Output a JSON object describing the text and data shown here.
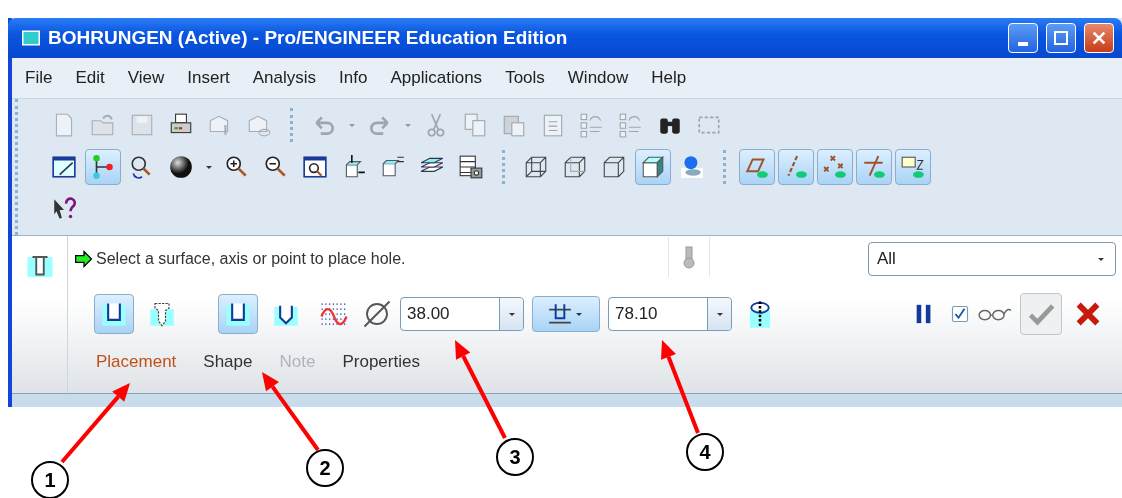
{
  "window": {
    "title": "BOHRUNGEN (Active) - Pro/ENGINEER Education Edition"
  },
  "menu": [
    "File",
    "Edit",
    "View",
    "Insert",
    "Analysis",
    "Info",
    "Applications",
    "Tools",
    "Window",
    "Help"
  ],
  "toolbars": [
    [
      {
        "kind": "new",
        "on": false,
        "disabled": true
      },
      {
        "kind": "open",
        "on": false,
        "disabled": true
      },
      {
        "kind": "save",
        "on": false,
        "disabled": true
      },
      {
        "kind": "print",
        "on": false,
        "disabled": false
      },
      {
        "kind": "mail",
        "on": false,
        "disabled": true
      },
      {
        "kind": "mail-link",
        "on": false,
        "disabled": true
      },
      {
        "kind": "separator"
      },
      {
        "kind": "undo",
        "on": false,
        "disabled": true
      },
      {
        "kind": "caret",
        "on": false,
        "disabled": true
      },
      {
        "kind": "redo",
        "on": false,
        "disabled": true
      },
      {
        "kind": "caret",
        "on": false,
        "disabled": true
      },
      {
        "kind": "cut",
        "on": false,
        "disabled": true
      },
      {
        "kind": "copy",
        "on": false,
        "disabled": true
      },
      {
        "kind": "paste",
        "on": false,
        "disabled": true
      },
      {
        "kind": "paste-special",
        "on": false,
        "disabled": true
      },
      {
        "kind": "regen",
        "on": false,
        "disabled": true
      },
      {
        "kind": "regen",
        "on": false,
        "disabled": true
      },
      {
        "kind": "find",
        "on": false,
        "disabled": false
      },
      {
        "kind": "select-box",
        "on": false,
        "disabled": true
      }
    ],
    [
      {
        "kind": "repaint",
        "on": false,
        "disabled": false
      },
      {
        "kind": "datum-display",
        "on": true,
        "disabled": false
      },
      {
        "kind": "orient",
        "on": false,
        "disabled": false
      },
      {
        "kind": "sphere",
        "on": false,
        "disabled": false
      },
      {
        "kind": "caret",
        "on": false,
        "disabled": false
      },
      {
        "kind": "zoom-in",
        "on": false,
        "disabled": false
      },
      {
        "kind": "zoom-out",
        "on": false,
        "disabled": false
      },
      {
        "kind": "refit",
        "on": false,
        "disabled": false
      },
      {
        "kind": "reorient",
        "on": false,
        "disabled": false
      },
      {
        "kind": "named-view",
        "on": false,
        "disabled": false
      },
      {
        "kind": "layers",
        "on": false,
        "disabled": false
      },
      {
        "kind": "table-camera",
        "on": false,
        "disabled": false
      },
      {
        "kind": "separator"
      },
      {
        "kind": "wireframe",
        "on": false,
        "disabled": false
      },
      {
        "kind": "hidden",
        "on": false,
        "disabled": false
      },
      {
        "kind": "no-hidden",
        "on": false,
        "disabled": false
      },
      {
        "kind": "shaded",
        "on": true,
        "disabled": false
      },
      {
        "kind": "lights",
        "on": false,
        "disabled": false
      },
      {
        "kind": "separator"
      },
      {
        "kind": "planes",
        "on": true,
        "disabled": false
      },
      {
        "kind": "axes",
        "on": true,
        "disabled": false
      },
      {
        "kind": "points",
        "on": true,
        "disabled": false
      },
      {
        "kind": "csys",
        "on": true,
        "disabled": false
      },
      {
        "kind": "notes",
        "on": true,
        "disabled": false
      }
    ],
    [
      {
        "kind": "help",
        "on": false,
        "disabled": false
      }
    ]
  ],
  "dashboard": {
    "message": "Select a surface, axis or point to place hole.",
    "filter": {
      "value": "All"
    },
    "controls": [
      {
        "kind": "straight",
        "on": true
      },
      {
        "kind": "standard",
        "on": false
      },
      {
        "kind": "gap"
      },
      {
        "kind": "flat",
        "on": true
      },
      {
        "kind": "drill",
        "on": false
      },
      {
        "kind": "sketch",
        "on": false
      },
      {
        "kind": "diameter",
        "value": "38.00"
      },
      {
        "kind": "depth-option",
        "on": true
      },
      {
        "kind": "depth",
        "value": "78.10"
      },
      {
        "kind": "flip",
        "on": false
      }
    ],
    "preview": {
      "checked": true
    },
    "tabs": [
      {
        "label": "Placement",
        "selected": true,
        "disabled": false
      },
      {
        "label": "Shape",
        "selected": false,
        "disabled": false
      },
      {
        "label": "Note",
        "selected": false,
        "disabled": true
      },
      {
        "label": "Properties",
        "selected": false,
        "disabled": false
      }
    ]
  },
  "callouts": [
    "1",
    "2",
    "3",
    "4"
  ]
}
